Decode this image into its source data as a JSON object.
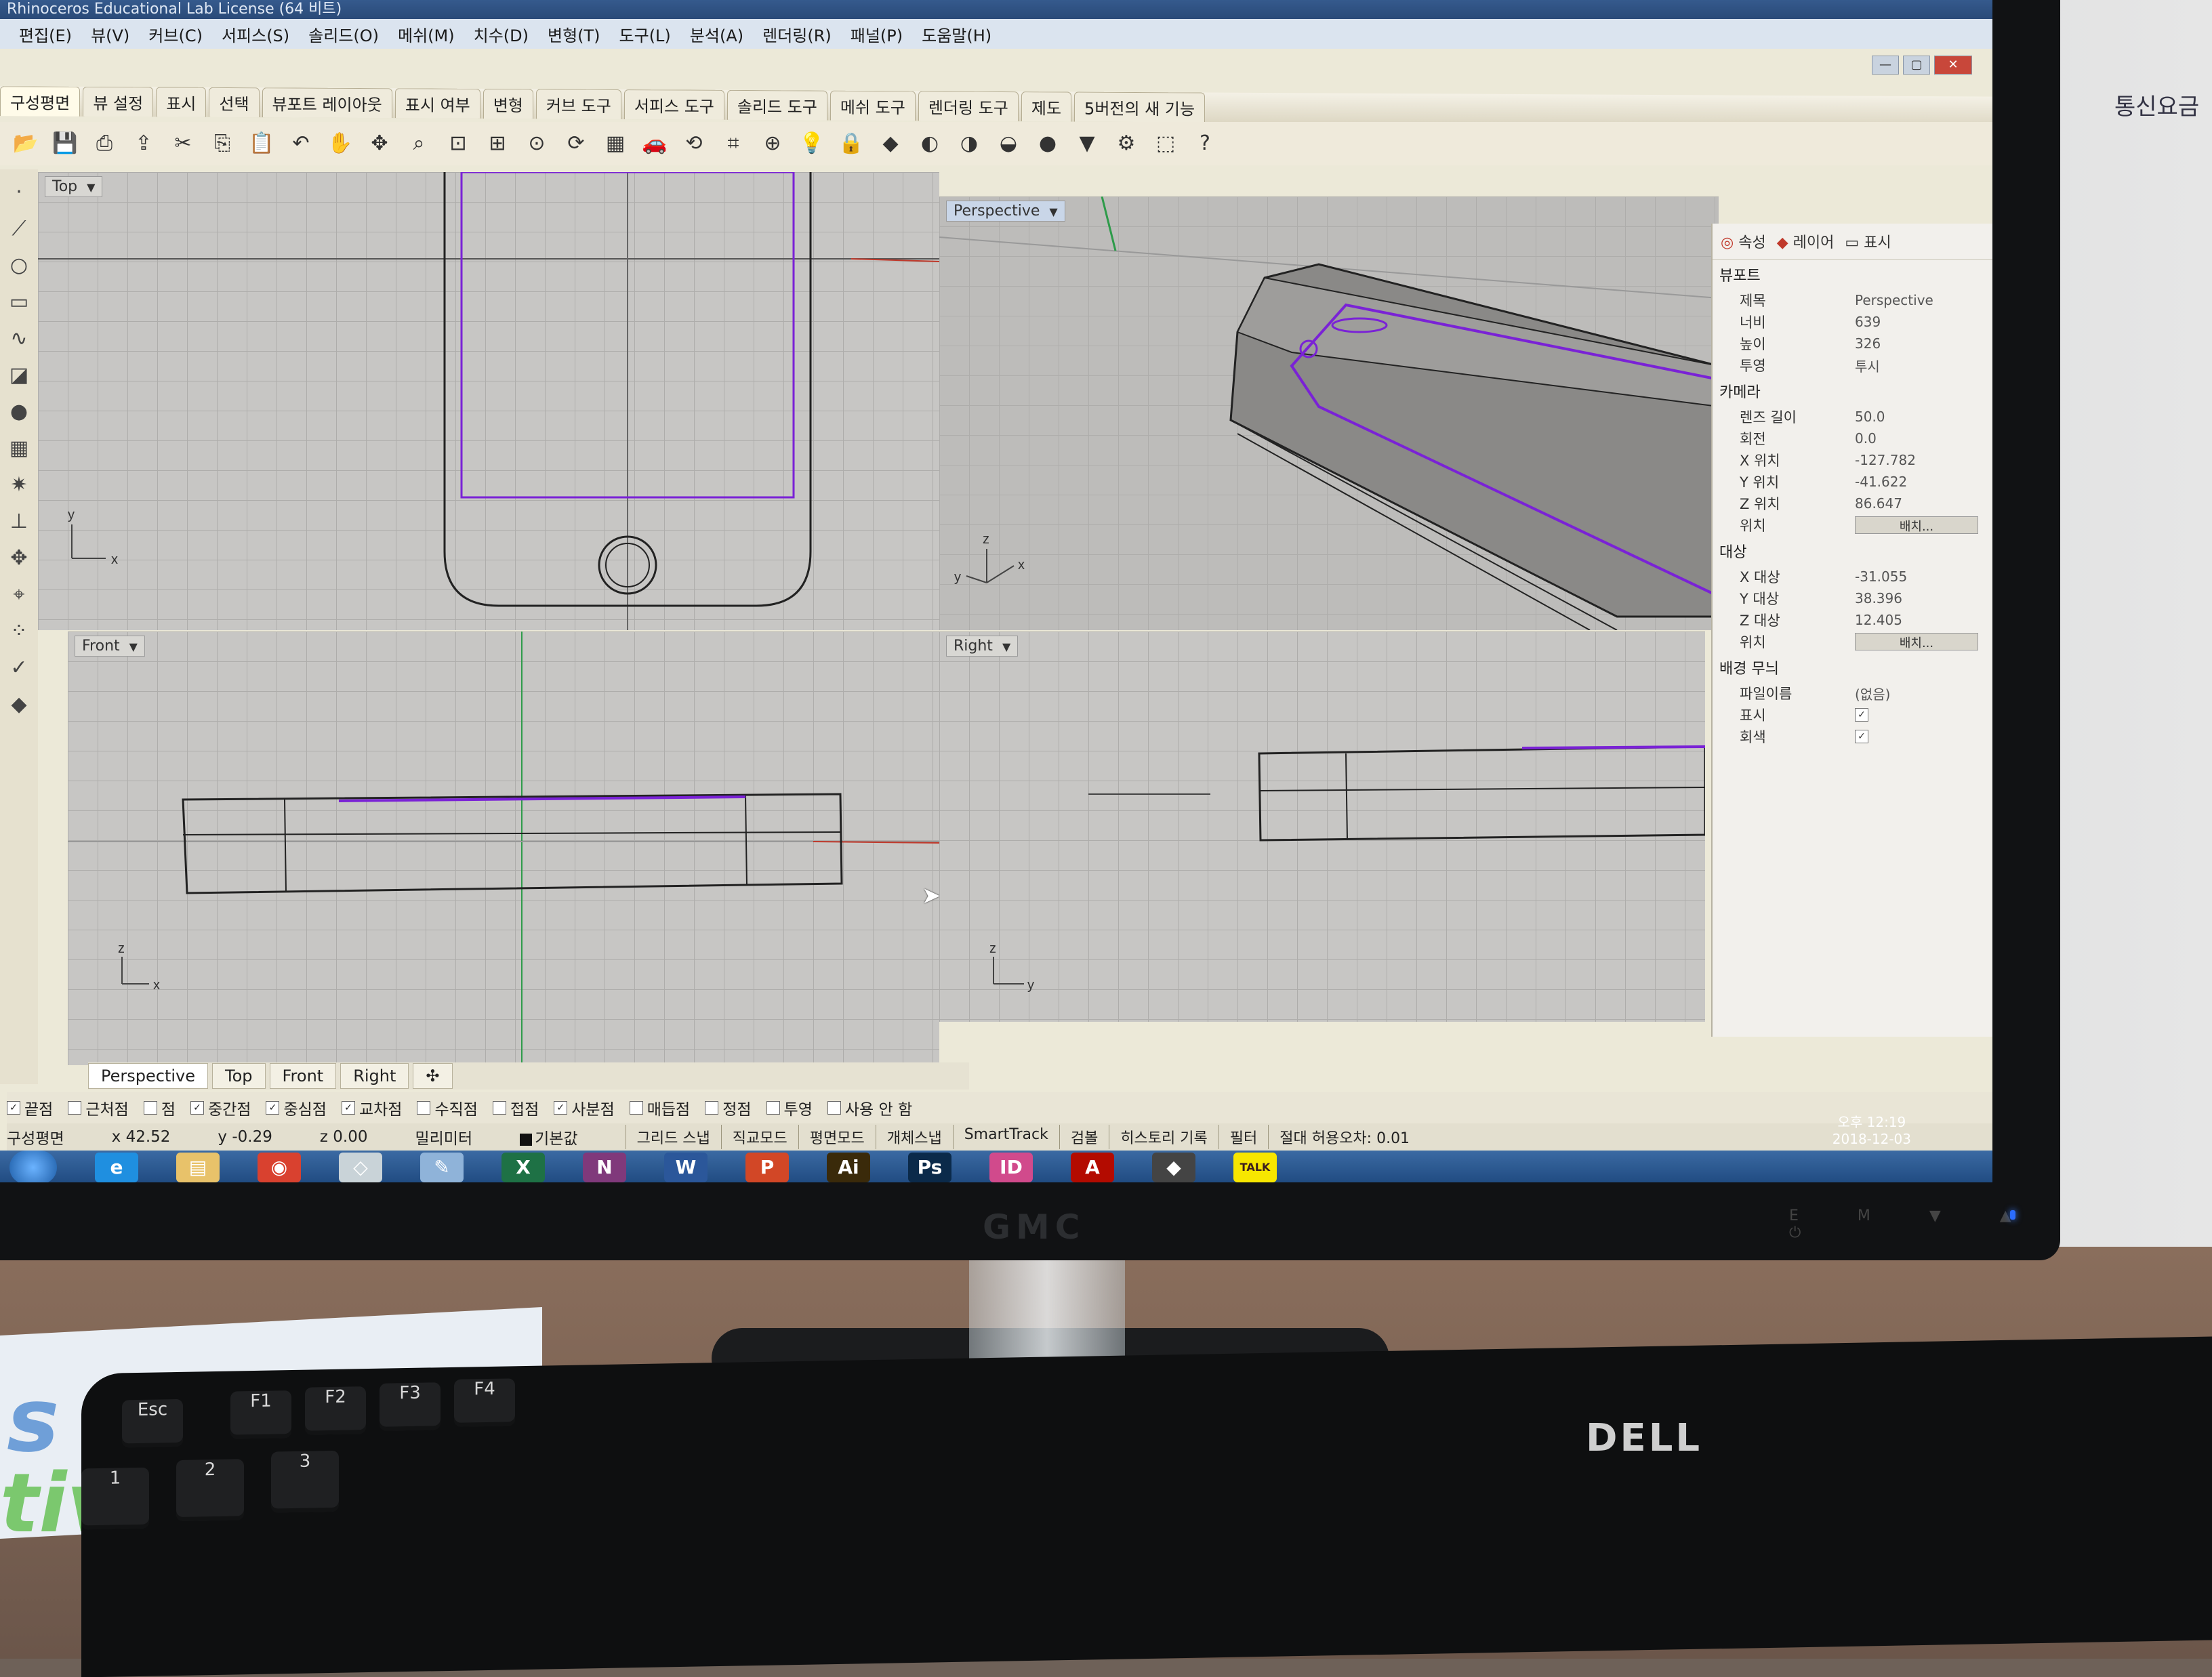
{
  "titlebar": {
    "text": "Rhinoceros Educational Lab License (64 비트)"
  },
  "menu": [
    "편집(E)",
    "뷰(V)",
    "커브(C)",
    "서피스(S)",
    "솔리드(O)",
    "메쉬(M)",
    "치수(D)",
    "변형(T)",
    "도구(L)",
    "분석(A)",
    "렌더링(R)",
    "패널(P)",
    "도움말(H)"
  ],
  "toolbar_tabs": [
    "구성평면",
    "뷰 설정",
    "표시",
    "선택",
    "뷰포트 레이아웃",
    "표시 여부",
    "변형",
    "커브 도구",
    "서피스 도구",
    "솔리드 도구",
    "메쉬 도구",
    "렌더링 도구",
    "제도",
    "5버전의 새 기능"
  ],
  "toolbar_icons": [
    "open-icon",
    "save-icon",
    "print-icon",
    "import-icon",
    "cut-icon",
    "copy-icon",
    "paste-icon",
    "undo-icon",
    "pan-icon",
    "rotate-icon",
    "zoom-icon",
    "zoom-window-icon",
    "zoom-extents-icon",
    "zoom-selected-icon",
    "rotate-view-icon",
    "viewport-layout-icon",
    "car-icon",
    "cplane-icon",
    "grid-icon",
    "named-view-icon",
    "light-icon",
    "lock-icon",
    "layer-icon",
    "render-icon",
    "shade-icon",
    "ghost-icon",
    "sphere-icon",
    "filter-icon",
    "settings-icon",
    "selection-icon",
    "help-icon"
  ],
  "viewports": {
    "top": {
      "label": "Top",
      "axis_x": "x",
      "axis_y": "y"
    },
    "perspective": {
      "label": "Perspective",
      "axis_x": "x",
      "axis_y": "y",
      "axis_z": "z"
    },
    "front": {
      "label": "Front",
      "axis_x": "x",
      "axis_z": "z"
    },
    "right": {
      "label": "Right",
      "axis_y": "y",
      "axis_z": "z"
    }
  },
  "viewport_tabs": [
    "Perspective",
    "Top",
    "Front",
    "Right"
  ],
  "panel": {
    "tabs": [
      "속성",
      "레이어",
      "표시"
    ],
    "viewport_section": "뷰포트",
    "viewport_rows": [
      {
        "key": "제목",
        "value": "Perspective"
      },
      {
        "key": "너비",
        "value": "639"
      },
      {
        "key": "높이",
        "value": "326"
      },
      {
        "key": "투영",
        "value": "투시"
      }
    ],
    "camera_section": "카메라",
    "camera_rows": [
      {
        "key": "렌즈 길이",
        "value": "50.0"
      },
      {
        "key": "회전",
        "value": "0.0"
      },
      {
        "key": "X 위치",
        "value": "-127.782"
      },
      {
        "key": "Y 위치",
        "value": "-41.622"
      },
      {
        "key": "Z 위치",
        "value": "86.647"
      }
    ],
    "position_label": "위치",
    "place_button": "배치...",
    "target_section": "대상",
    "target_rows": [
      {
        "key": "X 대상",
        "value": "-31.055"
      },
      {
        "key": "Y 대상",
        "value": "38.396"
      },
      {
        "key": "Z 대상",
        "value": "12.405"
      }
    ],
    "background_section": "배경 무늬",
    "file_label": "파일이름",
    "file_value": "(없음)",
    "show_label": "표시",
    "gray_label": "회색"
  },
  "osnaps": [
    {
      "label": "끝점",
      "checked": true
    },
    {
      "label": "근처점",
      "checked": false
    },
    {
      "label": "점",
      "checked": false
    },
    {
      "label": "중간점",
      "checked": true
    },
    {
      "label": "중심점",
      "checked": true
    },
    {
      "label": "교차점",
      "checked": true
    },
    {
      "label": "수직점",
      "checked": false
    },
    {
      "label": "접점",
      "checked": false
    },
    {
      "label": "사분점",
      "checked": true
    },
    {
      "label": "매듭점",
      "checked": false
    },
    {
      "label": "정점",
      "checked": false
    },
    {
      "label": "투영",
      "checked": false
    },
    {
      "label": "사용 안 함",
      "checked": false
    }
  ],
  "status": {
    "cplane": "구성평면",
    "x": "x 42.52",
    "y": "y -0.29",
    "z": "z 0.00",
    "units": "밀리미터",
    "layer": "기본값",
    "buttons": [
      "그리드 스냅",
      "직교모드",
      "평면모드",
      "개체스냅",
      "SmartTrack",
      "검볼",
      "히스토리 기록",
      "필터",
      "절대 허용오차: 0.01"
    ]
  },
  "taskbar": {
    "apps": [
      {
        "name": "ie-icon",
        "label": "e",
        "color": "#1f8fe0"
      },
      {
        "name": "folder-icon",
        "label": "▤",
        "color": "#e8c26a"
      },
      {
        "name": "chrome-icon",
        "label": "◉",
        "color": "#d9412f"
      },
      {
        "name": "app-icon",
        "label": "◇",
        "color": "#c9d3d8"
      },
      {
        "name": "paint-icon",
        "label": "✎",
        "color": "#8fb3d9"
      },
      {
        "name": "excel-icon",
        "label": "X",
        "color": "#1e7145"
      },
      {
        "name": "onenote-icon",
        "label": "N",
        "color": "#80397b"
      },
      {
        "name": "word-icon",
        "label": "W",
        "color": "#2b579a"
      },
      {
        "name": "powerpoint-icon",
        "label": "P",
        "color": "#d24726"
      },
      {
        "name": "illustrator-icon",
        "label": "Ai",
        "color": "#3a2a0a"
      },
      {
        "name": "photoshop-icon",
        "label": "Ps",
        "color": "#0b2a4a"
      },
      {
        "name": "indesign-icon",
        "label": "ID",
        "color": "#d14a8c"
      },
      {
        "name": "acrobat-icon",
        "label": "A",
        "color": "#b30b00"
      },
      {
        "name": "rhino-icon",
        "label": "◆",
        "color": "#444444"
      },
      {
        "name": "kakaotalk-icon",
        "label": "TALK",
        "color": "#f7e600"
      }
    ],
    "time": "오후 12:19",
    "date": "2018-12-03"
  },
  "monitor_brand": "GMC",
  "monitor_buttons": "E M ▼ ▲ ⏻",
  "keyboard_brand": "DELL",
  "wall_sign": "통신요금",
  "paper_text_1": "s be",
  "paper_text_2": "tiv",
  "colors": {
    "curve_purple": "#7a22d6",
    "axis_red": "#c0392b",
    "axis_green": "#2e9b4a"
  }
}
